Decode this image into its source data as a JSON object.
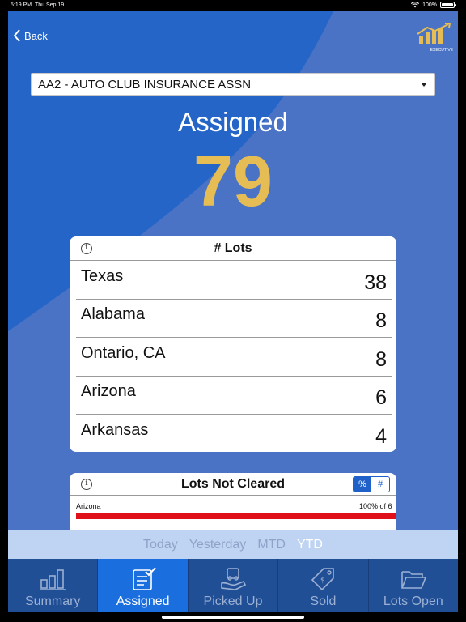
{
  "status": {
    "time": "5:19 PM",
    "date": "Thu Sep 19",
    "battery": "100%"
  },
  "nav": {
    "back_label": "Back",
    "logo_text": "EXECUTIVE"
  },
  "dropdown": {
    "selected": "AA2 - AUTO CLUB INSURANCE ASSN"
  },
  "summary": {
    "title": "Assigned",
    "value": "79"
  },
  "lots_card": {
    "title": "# Lots",
    "rows": [
      {
        "name": "Texas",
        "value": "38"
      },
      {
        "name": "Alabama",
        "value": "8"
      },
      {
        "name": "Ontario, CA",
        "value": "8"
      },
      {
        "name": "Arizona",
        "value": "6"
      },
      {
        "name": "Arkansas",
        "value": "4"
      }
    ]
  },
  "not_cleared_card": {
    "title": "Lots Not Cleared",
    "toggle": {
      "percent": "%",
      "count": "#",
      "selected": "percent"
    },
    "bars": [
      {
        "label": "Arizona",
        "pct_text": "100% of 6",
        "fraction": 1.0
      }
    ]
  },
  "periods": {
    "items": [
      "Today",
      "Yesterday",
      "MTD",
      "YTD"
    ],
    "active": "YTD"
  },
  "tabs": {
    "items": [
      {
        "label": "Summary",
        "icon": "bar-chart-icon"
      },
      {
        "label": "Assigned",
        "icon": "clipboard-check-icon"
      },
      {
        "label": "Picked Up",
        "icon": "hand-car-icon"
      },
      {
        "label": "Sold",
        "icon": "price-tag-icon"
      },
      {
        "label": "Lots Open",
        "icon": "folder-open-icon"
      }
    ],
    "active": "Assigned"
  },
  "colors": {
    "background": "#4a73c5",
    "accent_number": "#e6bd55",
    "tab_active": "#1a6ede",
    "tab_bar": "#214f96",
    "bar_red": "#e0101a"
  }
}
